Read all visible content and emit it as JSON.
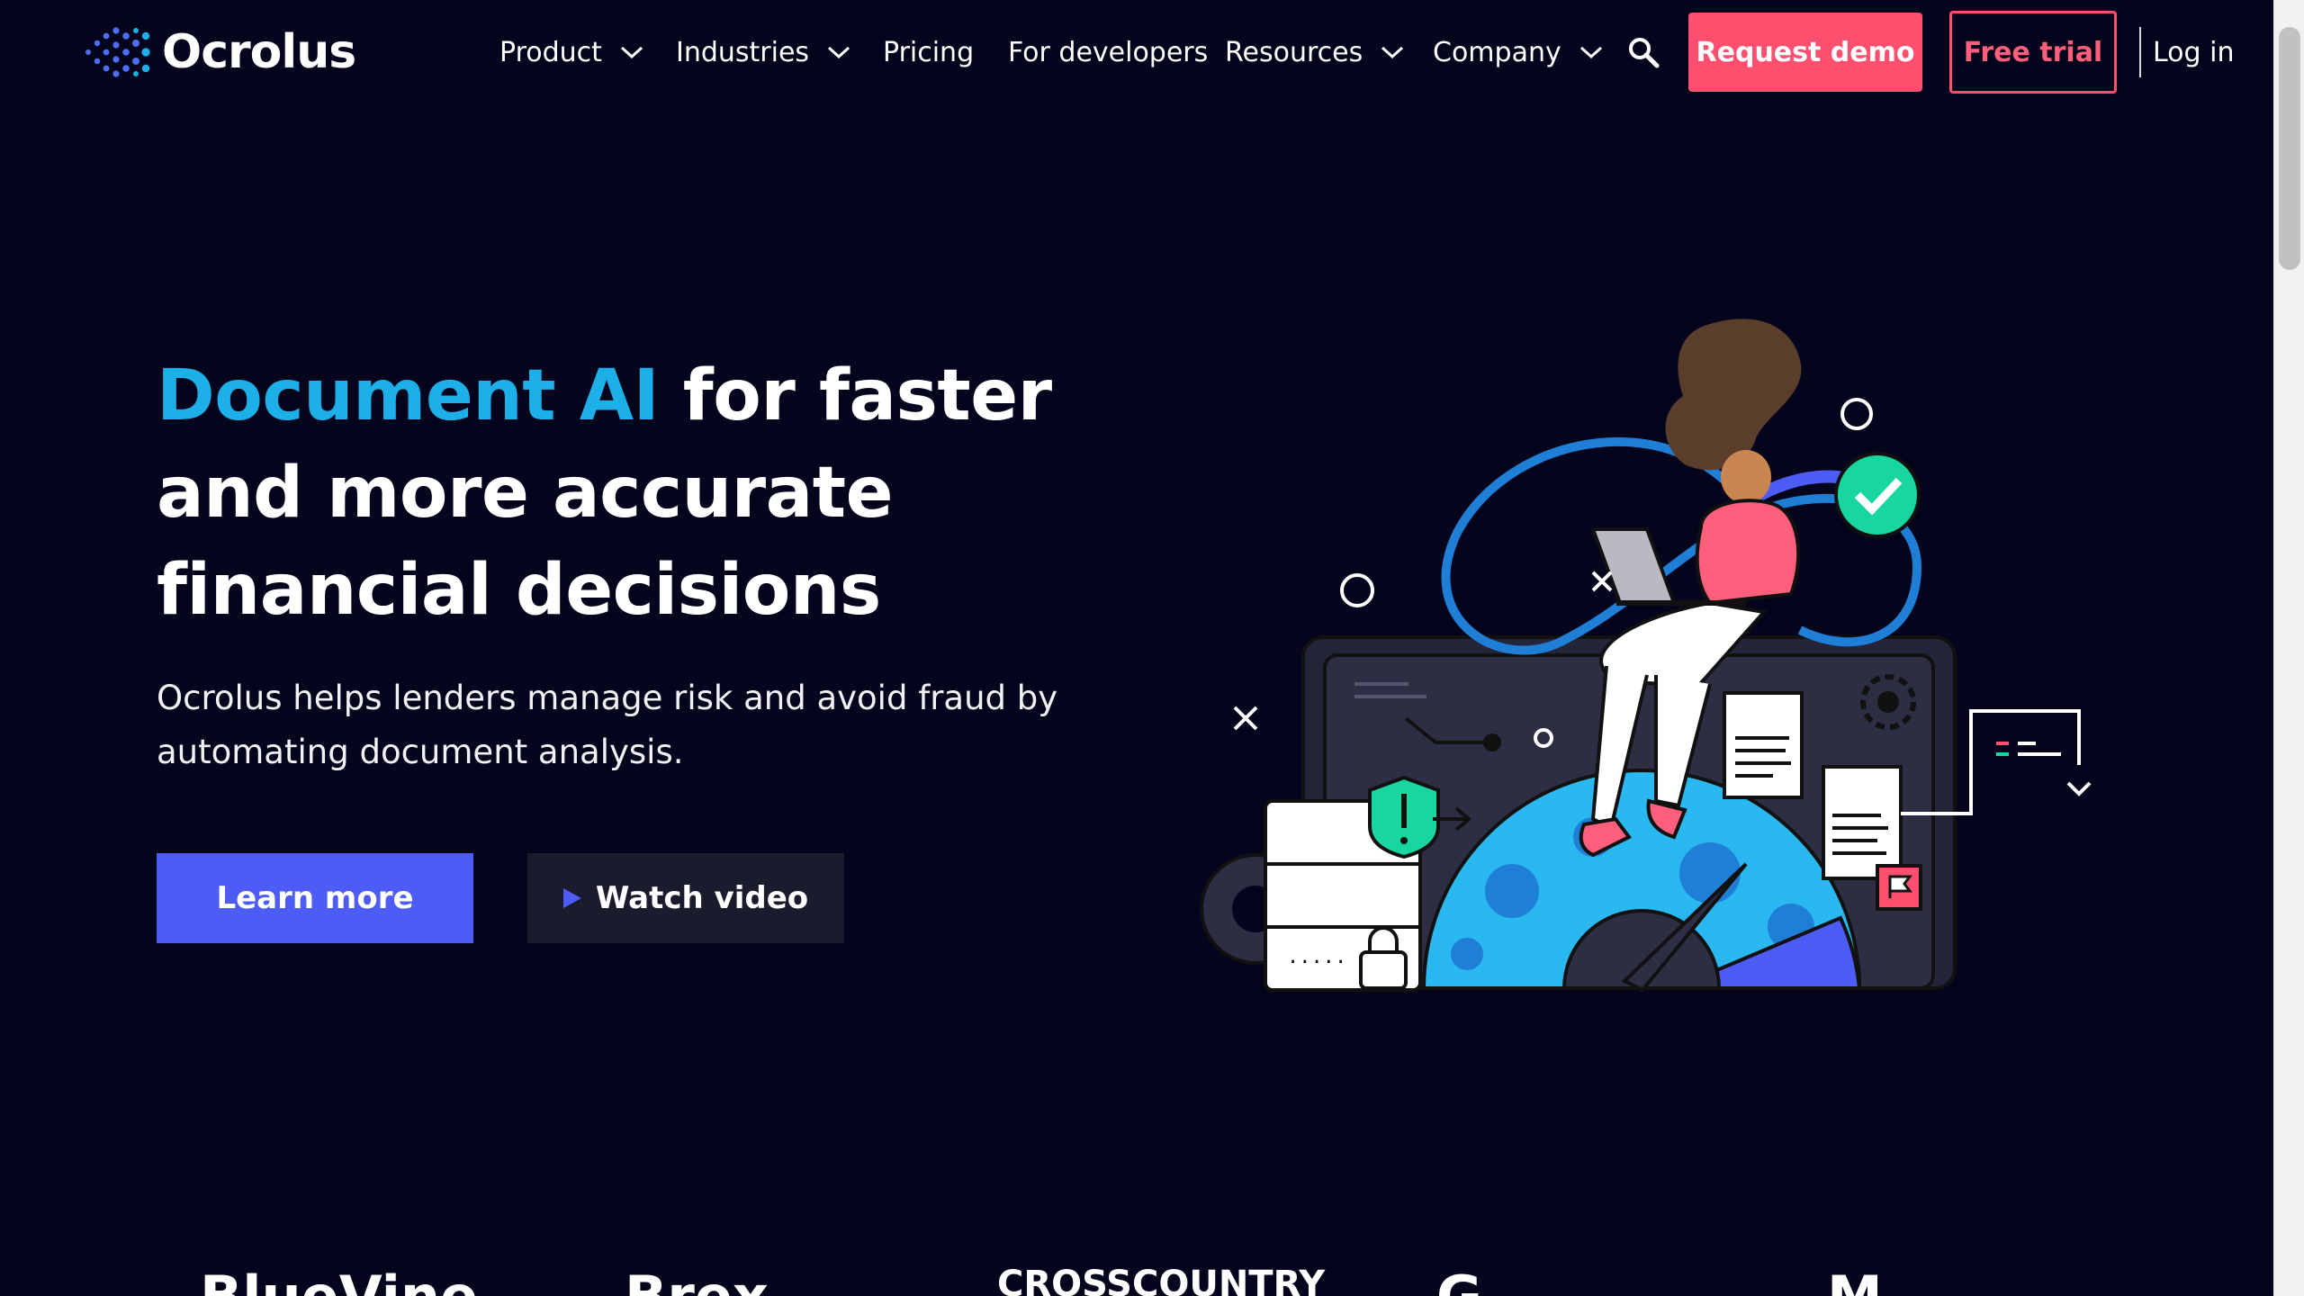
{
  "brand": {
    "name": "Ocrolus"
  },
  "nav": {
    "items": [
      {
        "label": "Product",
        "has_dropdown": true
      },
      {
        "label": "Industries",
        "has_dropdown": true
      },
      {
        "label": "Pricing",
        "has_dropdown": false
      },
      {
        "label": "For developers",
        "has_dropdown": false
      },
      {
        "label": "Resources",
        "has_dropdown": true
      },
      {
        "label": "Company",
        "has_dropdown": true
      }
    ],
    "search_icon": "search-icon",
    "request_demo_label": "Request demo",
    "free_trial_label": "Free trial",
    "login_label": "Log in"
  },
  "hero": {
    "title_accent": "Document AI",
    "title_rest": " for faster and more accurate financial decisions",
    "subtitle": "Ocrolus helps lenders manage risk and avoid fraud by automating document analysis.",
    "learn_more_label": "Learn more",
    "watch_video_label": "Watch video"
  },
  "logos": {
    "items": [
      "BlueVine",
      "Brex",
      "CROSSCOUNTRY",
      "G",
      "M"
    ]
  },
  "colors": {
    "background": "#04041d",
    "accent_blue": "#1db0e8",
    "brand_pink": "#ff4f6e",
    "primary_button": "#4d5cf5",
    "secondary_button": "#1b1b2e"
  }
}
